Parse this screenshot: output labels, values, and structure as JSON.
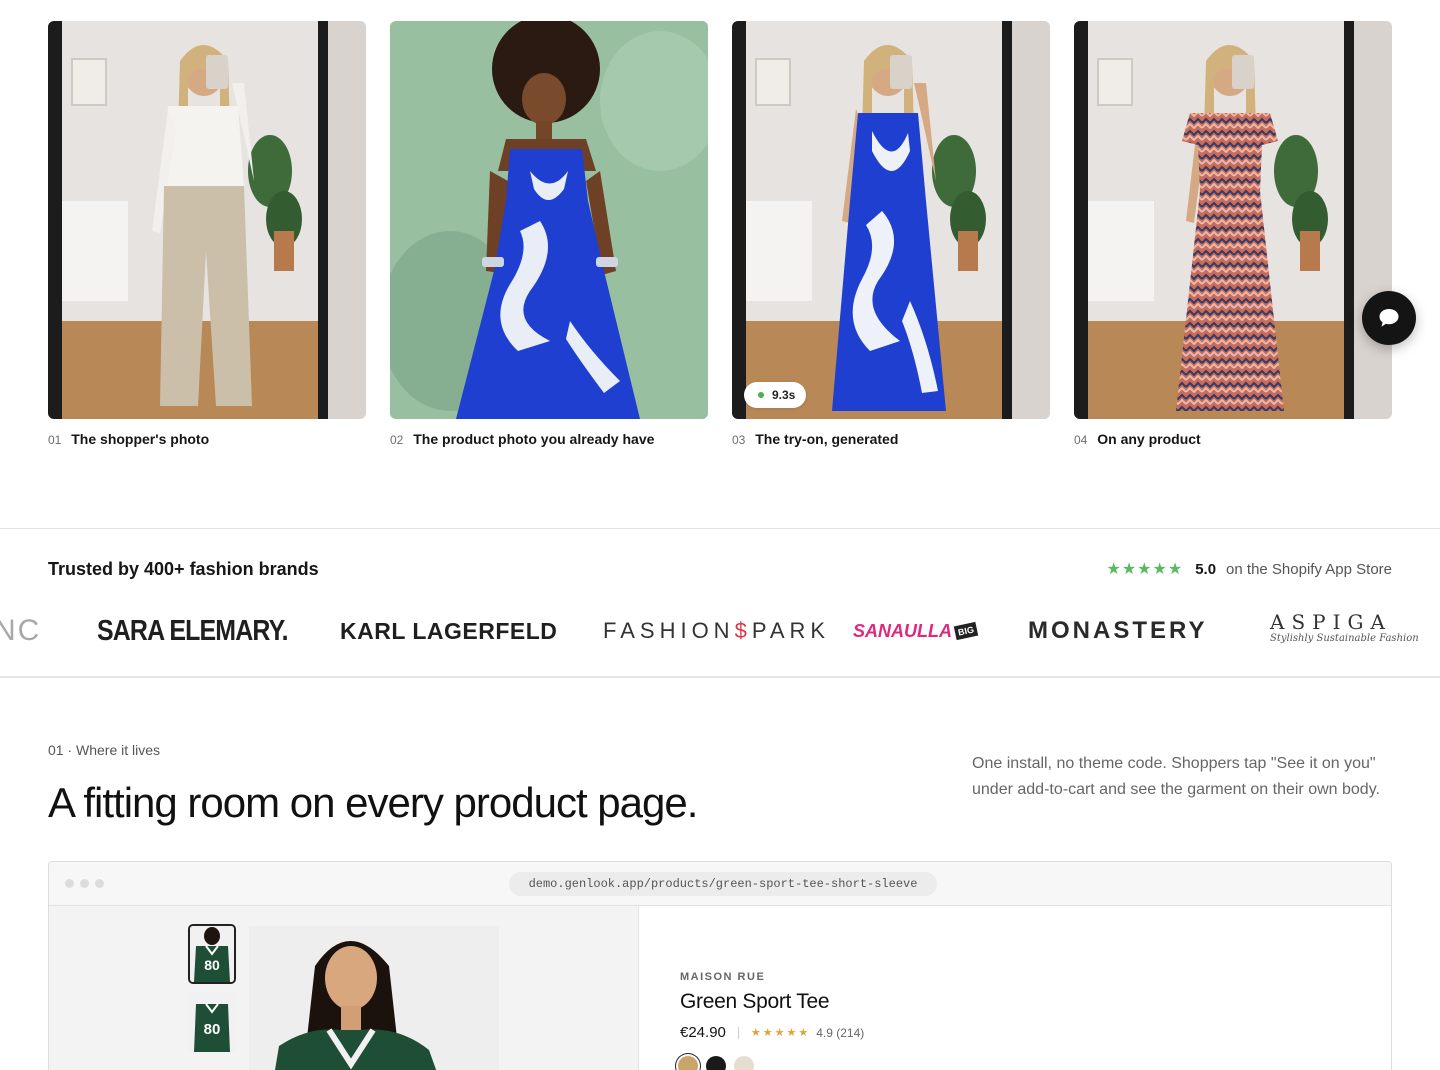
{
  "showcase": {
    "cards": [
      {
        "num": "01",
        "title": "The shopper's photo"
      },
      {
        "num": "02",
        "title": "The product photo you already have"
      },
      {
        "num": "03",
        "title": "The try-on, generated"
      },
      {
        "num": "04",
        "title": "On any product"
      }
    ],
    "timer_badge": "9.3s",
    "chat_icon": "chat-bubble-icon"
  },
  "trusted": {
    "title": "Trusted by 400+ fashion brands",
    "stars": "★★★★★",
    "score": "5.0",
    "source": "on the Shopify App Store",
    "logos": {
      "partial": "NC",
      "sara": "SARA ELEMARY.",
      "karl": "KARL LAGERFELD",
      "fashionpark_a": "FASHION",
      "fashionpark_sep": "$",
      "fashionpark_b": "PARK",
      "sanaulla": "SANAULLA",
      "sanaulla_tag": "BIG",
      "monastery": "MONASTERY",
      "aspiga": "ASPIGA",
      "aspiga_tagline": "Stylishly Sustainable Fashion"
    }
  },
  "section": {
    "eyebrow": "01 · Where it lives",
    "headline": "A fitting room on every product page.",
    "intro": "One install, no theme code. Shoppers tap \"See it on you\" under add-to-cart and see the garment on their own body."
  },
  "demo": {
    "url": "demo.genlook.app/products/green-sport-tee-short-sleeve",
    "brand": "MAISON RUE",
    "product": "Green Sport Tee",
    "price": "€24.90",
    "stars": "★★★★★",
    "rating": "4.9 (214)",
    "jersey_number": "80",
    "swatches": [
      "#c8a66b",
      "#1a1a1a",
      "#e4ddd0"
    ]
  },
  "colors": {
    "accent_green": "#5bb85c",
    "star_gold": "#e2a33a",
    "dress_blue": "#1f3fd1",
    "jersey_green": "#1f4e36"
  }
}
